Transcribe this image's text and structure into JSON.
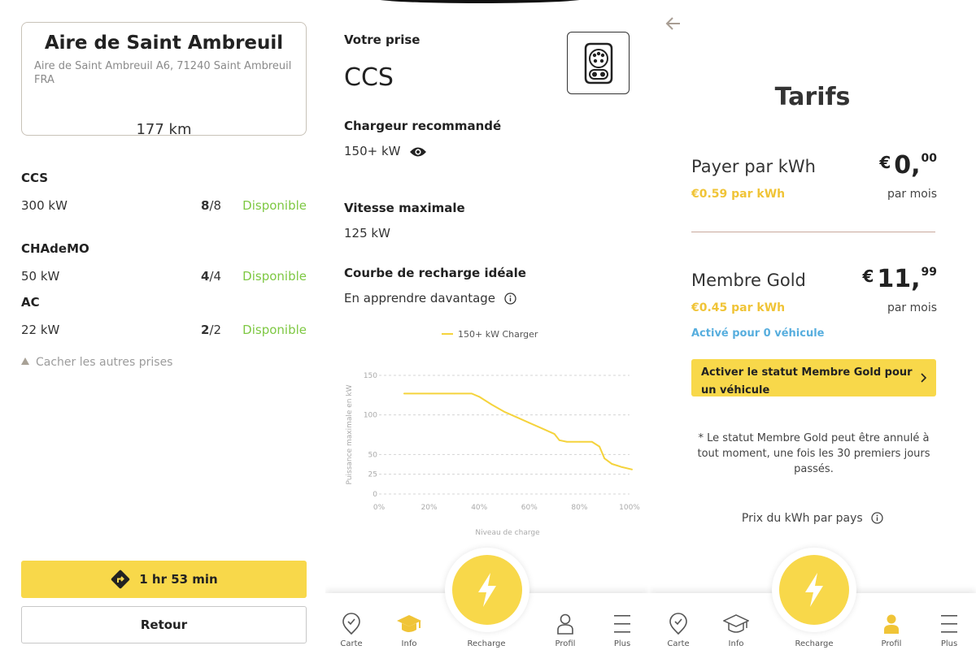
{
  "station_panel": {
    "name": "Aire de Saint Ambreuil",
    "address": "Aire de Saint Ambreuil A6, 71240 Saint Ambreuil FRA",
    "distance": "177 km",
    "connectors": [
      {
        "name": "CCS",
        "power": "300 kW",
        "available": "8",
        "total": "/8",
        "status": "Disponible"
      },
      {
        "name": "CHAdeMO",
        "power": "50 kW",
        "available": "4",
        "total": "/4",
        "status": "Disponible"
      },
      {
        "name": "AC",
        "power": "22 kW",
        "available": "2",
        "total": "/2",
        "status": "Disponible"
      }
    ],
    "hide_link": "Cacher les autres prises",
    "route_button": "1 hr 53 min",
    "back_button": "Retour"
  },
  "info_panel": {
    "plug_label": "Votre prise",
    "plug_value": "CCS",
    "recommended_label": "Chargeur recommandé",
    "recommended_value": "150+ kW",
    "max_speed_label": "Vitesse maximale",
    "max_speed_value": "125 kW",
    "curve_label": "Courbe de recharge idéale",
    "learn_more": "En apprendre davantage",
    "icons": [
      "ccs-plug-icon",
      "eye-icon",
      "info-icon"
    ]
  },
  "chart_data": {
    "type": "line",
    "series": [
      {
        "name": "150+ kW Charger",
        "color": "#f5d33c",
        "x": [
          10,
          20,
          30,
          37,
          40,
          45,
          50,
          55,
          60,
          65,
          70,
          72,
          75,
          80,
          85,
          88,
          90,
          93,
          97,
          101
        ],
        "y": [
          127,
          127,
          127,
          127,
          123,
          113,
          104,
          97,
          90,
          83,
          76,
          68,
          66,
          66,
          66,
          60,
          45,
          38,
          34,
          31
        ]
      }
    ],
    "xlabel": "Niveau de charge",
    "ylabel": "Puissance maximale en kW",
    "xticks": [
      "0%",
      "20%",
      "40%",
      "60%",
      "80%",
      "100%"
    ],
    "yticks": [
      0,
      25,
      50,
      100,
      150
    ],
    "xlim": [
      0,
      100
    ],
    "ylim": [
      0,
      150
    ],
    "grid": true,
    "legend": "top-center"
  },
  "tarifs_panel": {
    "title": "Tarifs",
    "plans": [
      {
        "title": "Payer par kWh",
        "rate": "€0.59 par kWh",
        "currency": "€",
        "price_int": "0,",
        "price_dec": "00",
        "period": "par mois"
      },
      {
        "title": "Membre Gold",
        "rate": "€0.45 par kWh",
        "currency": "€",
        "price_int": "11,",
        "price_dec": "99",
        "period": "par mois"
      }
    ],
    "activated": "Activé pour 0 véhicule",
    "gold_button": "Activer le statut Membre Gold pour un véhicule",
    "note": "* Le statut Membre Gold peut être annulé à tout moment, une fois les 30 premiers jours passés.",
    "country_link": "Prix du kWh par pays"
  },
  "nav": {
    "carte": "Carte",
    "info": "Info",
    "recharge": "Recharge",
    "profil": "Profil",
    "plus": "Plus",
    "active_color": "#f0c437",
    "inactive_color": "#555555"
  },
  "colors": {
    "accent_yellow": "#f8d84a",
    "available_green": "#7ec843",
    "link_blue": "#57aede"
  }
}
